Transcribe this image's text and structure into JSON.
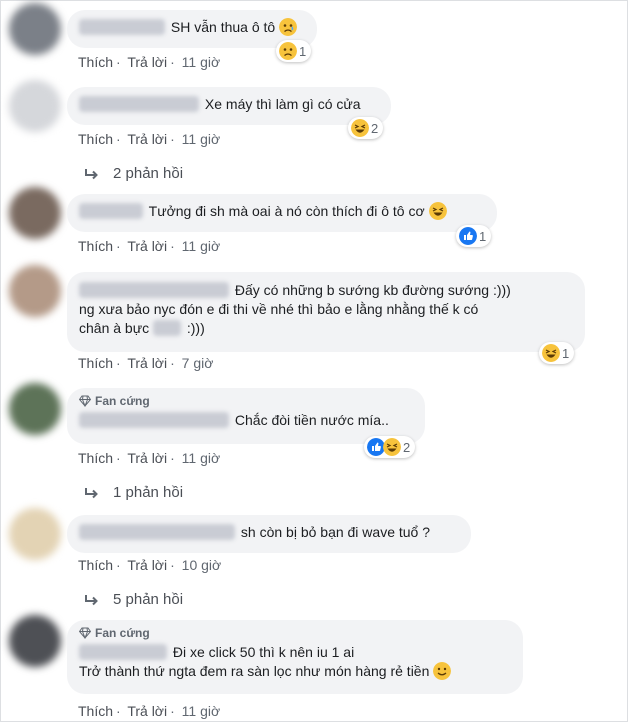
{
  "comments": [
    {
      "text_lines": [
        "SH vẫn thua ô tô"
      ],
      "reaction_count": "1",
      "like": "Thích",
      "reply": "Trả lời",
      "time": "11 giờ"
    },
    {
      "text_lines": [
        "Xe máy thì làm gì có cửa"
      ],
      "reaction_count": "2",
      "like": "Thích",
      "reply": "Trả lời",
      "time": "11 giờ",
      "replies": "2 phản hồi"
    },
    {
      "text_lines": [
        "Tưởng đi sh mà oai à nó còn thích đi ô tô cơ"
      ],
      "reaction_count": "1",
      "like": "Thích",
      "reply": "Trả lời",
      "time": "11 giờ"
    },
    {
      "text_lines": [
        "Đấy có những b sướng kb đường sướng :)))",
        "ng xưa bảo nyc đón e đi thi về nhé thì bảo e lằng nhằng thế k có",
        "chân à bực",
        ":)))"
      ],
      "reaction_count": "1",
      "like": "Thích",
      "reply": "Trả lời",
      "time": "7 giờ"
    },
    {
      "badge": "Fan cứng",
      "text_lines": [
        "Chắc đòi tiền nước mía.."
      ],
      "reaction_count": "2",
      "like": "Thích",
      "reply": "Trả lời",
      "time": "11 giờ",
      "replies": "1 phản hồi"
    },
    {
      "text_lines": [
        "sh còn bị bỏ bạn đi wave tuổ ?"
      ],
      "like": "Thích",
      "reply": "Trả lời",
      "time": "10 giờ",
      "replies": "5 phản hồi"
    },
    {
      "badge": "Fan cứng",
      "text_lines": [
        "Đi xe click 50 thì k nên iu 1 ai",
        "Trở thành thứ ngta đem ra sàn lọc như món hàng rẻ tiền"
      ],
      "like": "Thích",
      "reply": "Trả lời",
      "time": "11 giờ"
    }
  ],
  "colors": {
    "bubble": "#f2f3f5",
    "link": "#4b4f56",
    "like_blue": "#1877f2",
    "emoji_yellow": "#f7c33c"
  },
  "icons": [
    "sad-emoji-icon",
    "haha-emoji-icon",
    "like-icon",
    "diamond-icon",
    "reply-arrow-icon",
    "smile-emoji-icon"
  ]
}
